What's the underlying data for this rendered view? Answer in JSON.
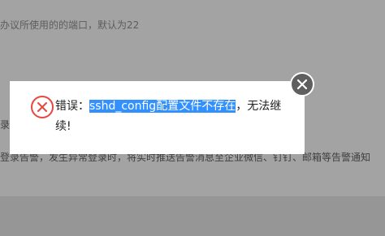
{
  "background": {
    "line1": "办议所使用的的端口，默认为22",
    "line2": "录，",
    "line3": "登录告警，发生异常登录时，将实时推送告警消息至企业微信、钉钉、邮箱等告警通知"
  },
  "dialog": {
    "prefix": "错误：",
    "highlighted": "sshd_config配置文件不存在",
    "suffix": "，无法继续!",
    "icon": "error-x-circle-icon",
    "close_icon": "close-icon"
  },
  "colors": {
    "error": "#e8473f",
    "highlight": "#3390ff",
    "close_bg": "#5f5f5f"
  }
}
